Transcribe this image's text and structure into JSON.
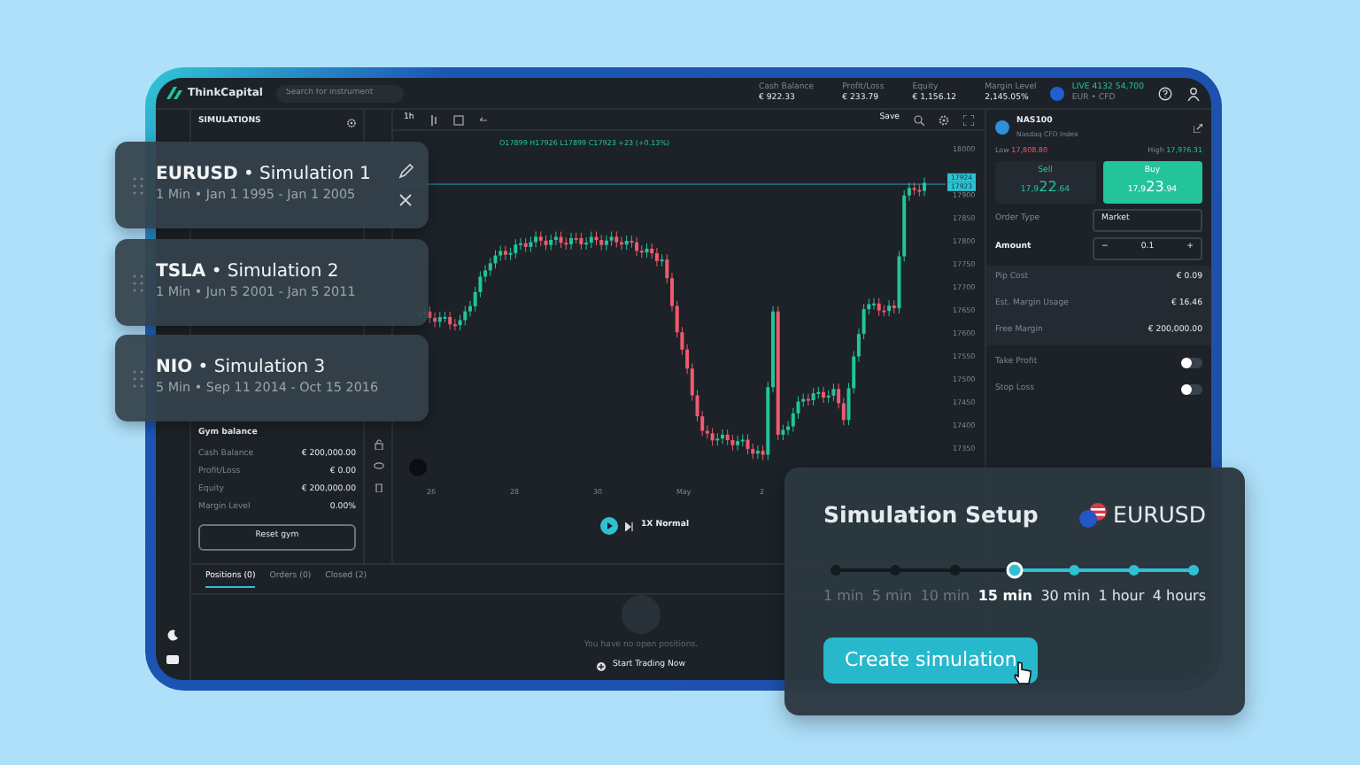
{
  "header": {
    "brand": "ThinkCapital",
    "search": {
      "placeholder": "Search for instrument"
    },
    "stats": [
      {
        "label": "Cash Balance",
        "value": "€ 922.33"
      },
      {
        "label": "Profit/Loss",
        "value": "€ 233.79"
      },
      {
        "label": "Equity",
        "value": "€ 1,156.12"
      },
      {
        "label": "Margin Level",
        "value": "2,145.05%"
      }
    ],
    "account": {
      "mode": "LIVE",
      "number": "4132 54,700",
      "type": "EUR • CFD"
    }
  },
  "simulations_panel": {
    "title": "SIMULATIONS",
    "gym_title": "Gym balance",
    "rows": [
      {
        "label": "Cash Balance",
        "value": "€ 200,000.00"
      },
      {
        "label": "Profit/Loss",
        "value": "€ 0.00"
      },
      {
        "label": "Equity",
        "value": "€ 200,000.00"
      },
      {
        "label": "Margin Level",
        "value": "0.00%"
      }
    ],
    "reset_button": "Reset gym"
  },
  "chart": {
    "timeframe": "1h",
    "save": "Save",
    "readout": "O17899 H17926 L17899 C17923 +23 (+0.13%)",
    "price_tags": [
      "17924",
      "17923"
    ],
    "y_labels": [
      "18000",
      "17900",
      "17850",
      "17800",
      "17750",
      "17700",
      "17650",
      "17600",
      "17550",
      "17500",
      "17450",
      "17400",
      "17350"
    ],
    "x_labels": [
      "26",
      "28",
      "30",
      "May",
      "2"
    ],
    "speed": "1X Normal"
  },
  "order_panel": {
    "instrument": "NAS100",
    "subtitle": "Nasdaq CFD Index",
    "low": {
      "label": "Low",
      "value": "17,808.80"
    },
    "high": {
      "label": "High",
      "value": "17,976.31"
    },
    "sides": [
      {
        "label": "Sell",
        "head": "17,9",
        "big": "22",
        "tail": ".64",
        "selected": false
      },
      {
        "label": "Buy",
        "head": "17,9",
        "big": "23",
        "tail": ".94",
        "selected": true
      }
    ],
    "order_type": {
      "label": "Order Type",
      "value": "Market"
    },
    "amount": {
      "label": "Amount",
      "value": "0.1",
      "decrement": "−",
      "increment": "+"
    },
    "info": [
      {
        "label": "Pip Cost",
        "value": "€ 0.09"
      },
      {
        "label": "Est. Margin Usage",
        "value": "€ 16.46"
      },
      {
        "label": "Free Margin",
        "value": "€ 200,000.00"
      }
    ],
    "toggles": [
      {
        "label": "Take Profit",
        "on": false
      },
      {
        "label": "Stop Loss",
        "on": false
      }
    ]
  },
  "bottom": {
    "tabs": [
      {
        "label": "Positions (0)",
        "selected": true
      },
      {
        "label": "Orders (0)",
        "selected": false
      },
      {
        "label": "Closed (2)",
        "selected": false
      }
    ],
    "empty_message": "You have no open positions.",
    "cta": "Start Trading Now"
  },
  "simulation_cards": [
    {
      "title": "**EURUSD** • Simulation 1",
      "details": "1 Min • Jan 1 1995 - Jan 1 2005",
      "editable": true
    },
    {
      "title": "**TSLA** • Simulation 2",
      "details": "1 Min • Jun 5 2001 - Jan 5 2011",
      "editable": false
    },
    {
      "title": "**NIO** • Simulation 3",
      "details": "5 Min • Sep 11 2014 - Oct 15 2016",
      "editable": false
    }
  ],
  "setup": {
    "title": "Simulation Setup",
    "pair": "EURUSD",
    "steps": [
      {
        "label": "1 min",
        "selected": false
      },
      {
        "label": "5 min",
        "selected": false
      },
      {
        "label": "10 min",
        "selected": false
      },
      {
        "label": "15 min",
        "selected": true
      },
      {
        "label": "30 min",
        "selected": false
      },
      {
        "label": "1 hour",
        "selected": false
      },
      {
        "label": "4 hours",
        "selected": false
      }
    ],
    "button": "Create simulation"
  }
}
